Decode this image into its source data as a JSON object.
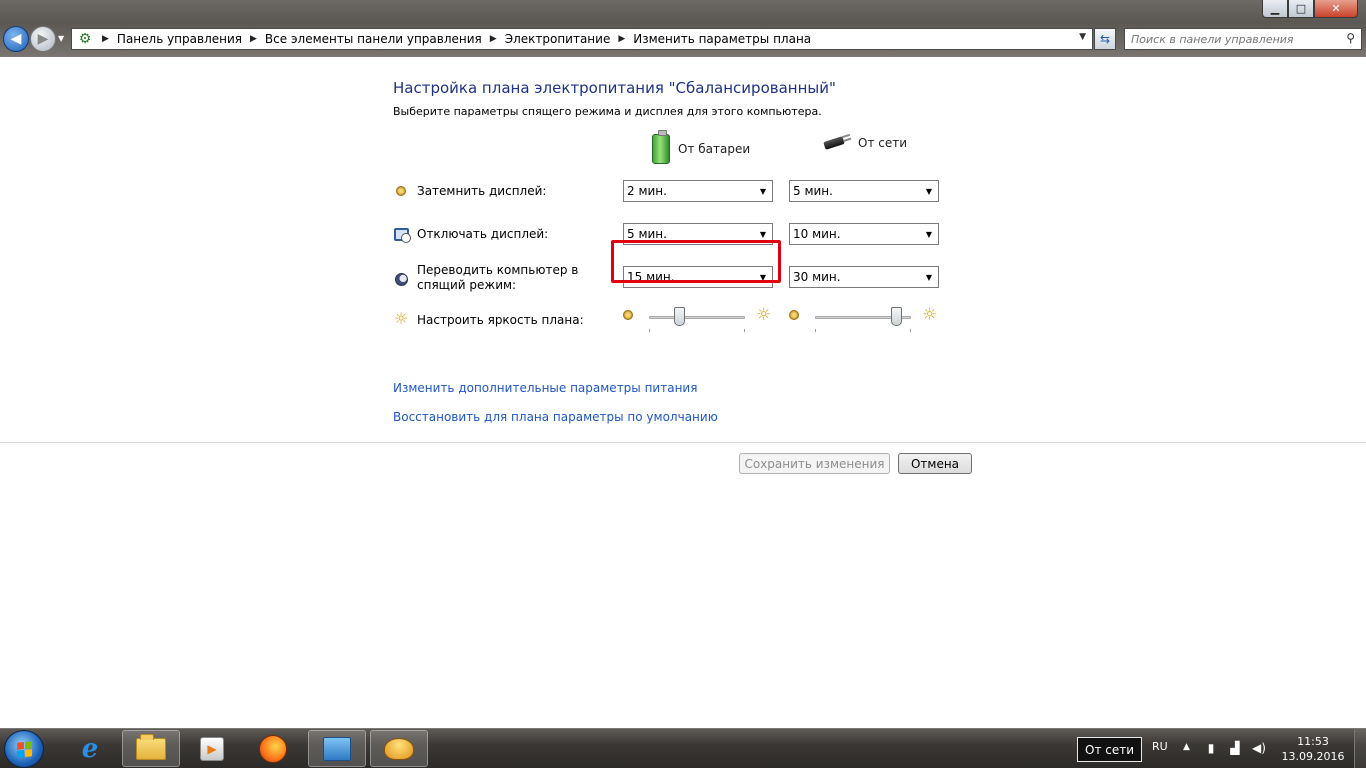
{
  "window": {
    "minimize": "▁",
    "maximize": "□",
    "close": "✕"
  },
  "address": {
    "crumbs": [
      "Панель управления",
      "Все элементы панели управления",
      "Электропитание",
      "Изменить параметры плана"
    ]
  },
  "search": {
    "placeholder": "Поиск в панели управления"
  },
  "page": {
    "title": "Настройка плана электропитания \"Сбалансированный\"",
    "subtitle": "Выберите параметры спящего режима и дисплея для этого компьютера.",
    "col_battery": "От батареи",
    "col_ac": "От сети",
    "rows": [
      {
        "label": "Затемнить дисплей:",
        "battery": "2 мин.",
        "ac": "5 мин."
      },
      {
        "label": "Отключать дисплей:",
        "battery": "5 мин.",
        "ac": "10 мин."
      },
      {
        "label": "Переводить компьютер в спящий режим:",
        "battery": "15 мин.",
        "ac": "30 мин."
      }
    ],
    "brightness": {
      "label": "Настроить яркость плана:",
      "battery_level": 0.32,
      "ac_level": 0.85
    },
    "link_advanced": "Изменить дополнительные параметры питания",
    "link_restore": "Восстановить для плана параметры по умолчанию",
    "btn_save": "Сохранить изменения",
    "btn_cancel": "Отмена"
  },
  "taskbar": {
    "tooltip": "От сети",
    "lang": "RU",
    "time": "11:53",
    "date": "13.09.2016"
  },
  "colors": {
    "title": "#1e3287",
    "link": "#1f56c9",
    "highlight": "#e00010"
  }
}
